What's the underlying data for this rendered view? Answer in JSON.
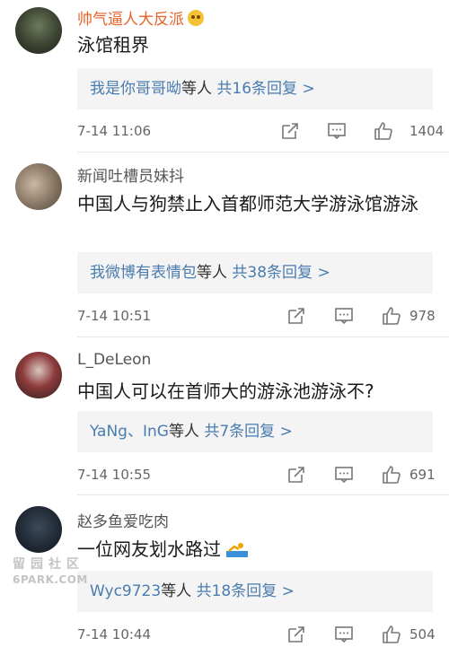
{
  "comments": [
    {
      "username": "帅气逼人大反派",
      "text": "泳馆租界",
      "reply_users": "我是你哥哥呦",
      "reply_suffix": "等人",
      "reply_count": "共16条回复",
      "time": "7-14 11:06",
      "likes": "1404"
    },
    {
      "username": "新闻吐槽员妹抖",
      "text": "中国人与狗禁止入首都师范大学游泳馆游泳",
      "reply_users": "我微博有表情包",
      "reply_suffix": "等人",
      "reply_count": "共38条回复",
      "time": "7-14 10:51",
      "likes": "978"
    },
    {
      "username": "L_DeLeon",
      "text": "中国人可以在首师大的游泳池游泳不?",
      "reply_users": "YaNg、InG",
      "reply_suffix": "等人",
      "reply_count": "共7条回复",
      "time": "7-14 10:55",
      "likes": "691"
    },
    {
      "username": "赵多鱼爱吃肉",
      "text": "一位网友划水路过",
      "reply_users": "Wyc9723",
      "reply_suffix": "等人",
      "reply_count": "共18条回复",
      "time": "7-14 10:44",
      "likes": "504"
    }
  ],
  "chevron": ">",
  "watermark": {
    "line1": "留园社区",
    "line2": "6PARK.COM"
  },
  "colors": {
    "vip_name": "#e8632a",
    "link": "#4a7cb0",
    "reply_bg": "#f4f4f4"
  }
}
